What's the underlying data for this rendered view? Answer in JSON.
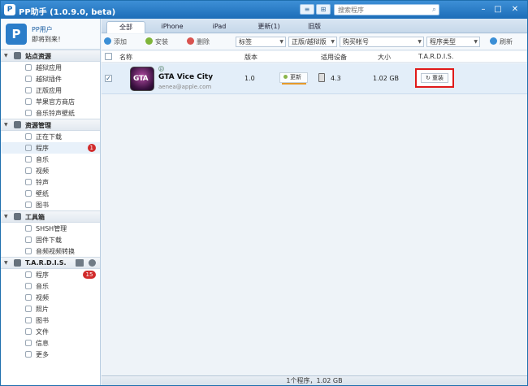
{
  "window": {
    "title": "PP助手 (1.0.9.0, beta)",
    "logo_glyph": "P",
    "view_list_glyph": "≡",
    "view_grid_glyph": "⊞",
    "minimize": "–",
    "maximize": "□",
    "close": "✕",
    "search_placeholder": "搜索程序",
    "search_icon": "⌕"
  },
  "user": {
    "avatar_glyph": "P",
    "name": "PP用户",
    "subtitle": "即将到来！"
  },
  "sidebar": {
    "groups": [
      {
        "label": "站点资源",
        "items": [
          {
            "label": "越狱应用"
          },
          {
            "label": "越狱插件"
          },
          {
            "label": "正版应用"
          },
          {
            "label": "苹果官方商店"
          },
          {
            "label": "音乐铃声壁纸"
          }
        ]
      },
      {
        "label": "资源管理",
        "items": [
          {
            "label": "正在下载"
          },
          {
            "label": "程序",
            "badge": "1"
          },
          {
            "label": "音乐"
          },
          {
            "label": "视频"
          },
          {
            "label": "铃声"
          },
          {
            "label": "壁纸"
          },
          {
            "label": "图书"
          }
        ]
      },
      {
        "label": "工具箱",
        "items": [
          {
            "label": "SHSH管理"
          },
          {
            "label": "固件下载"
          },
          {
            "label": "音频视频转换"
          }
        ]
      },
      {
        "label": "T.A.R.D.I.S.",
        "items": [
          {
            "label": "程序",
            "badge": "15"
          },
          {
            "label": "音乐"
          },
          {
            "label": "视频"
          },
          {
            "label": "照片"
          },
          {
            "label": "图书"
          },
          {
            "label": "文件"
          },
          {
            "label": "信息"
          },
          {
            "label": "更多"
          }
        ]
      }
    ]
  },
  "tabs": [
    "全部",
    "iPhone",
    "iPad",
    "更新(1)",
    "旧版"
  ],
  "toolbar": {
    "add": "添加",
    "install": "安装",
    "delete": "删除",
    "refresh": "刷新",
    "filters": [
      "标签",
      "正版/越狱版",
      "购买帐号",
      "程序类型"
    ]
  },
  "columns": {
    "name": "名称",
    "version": "版本",
    "device": "适用设备",
    "size": "大小",
    "tardis": "T.A.R.D.I.S."
  },
  "apps": [
    {
      "icon_text": "GTA",
      "badge_glyph": "p",
      "name": "GTA Vice City",
      "email": "aenea@apple.com",
      "version": "1.0",
      "update_label": "更新",
      "device_version": "4.3",
      "size": "1.02 GB",
      "tardis_action": "重装",
      "checked": "✓"
    }
  ],
  "status": "1个程序，1.02 GB",
  "colors": {
    "accent": "#1c6db8",
    "highlight": "#e01a1a",
    "badge": "#d12b2b"
  }
}
